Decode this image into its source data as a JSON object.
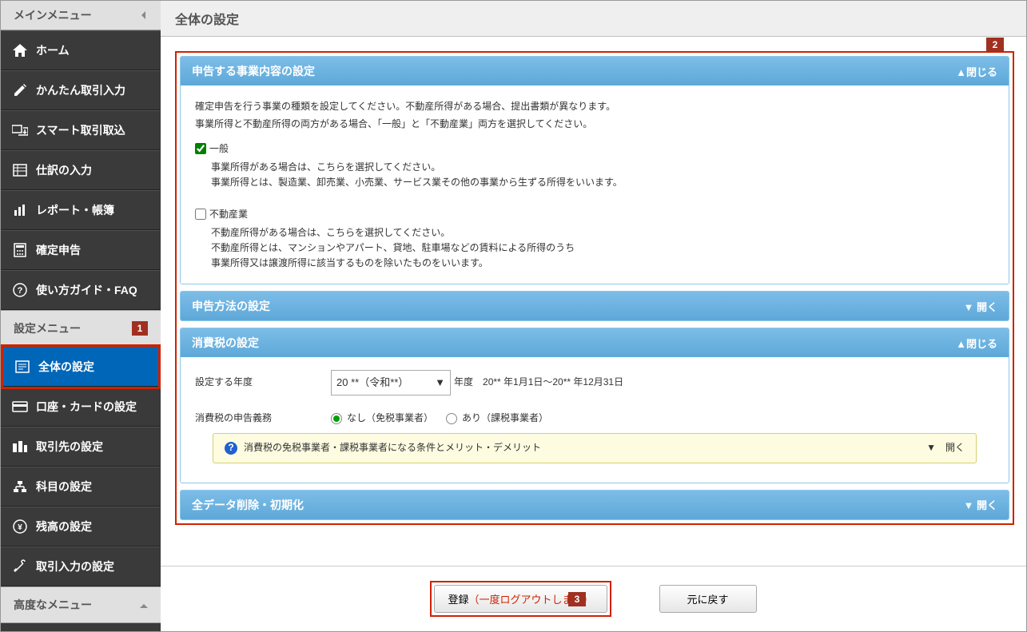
{
  "sidebar": {
    "main_menu_header": "メインメニュー",
    "items": [
      {
        "label": "ホーム"
      },
      {
        "label": "かんたん取引入力"
      },
      {
        "label": "スマート取引取込"
      },
      {
        "label": "仕訳の入力"
      },
      {
        "label": "レポート・帳簿"
      },
      {
        "label": "確定申告"
      },
      {
        "label": "使い方ガイド・FAQ"
      }
    ],
    "settings_header": "設定メニュー",
    "settings_items": [
      {
        "label": "全体の設定"
      },
      {
        "label": "口座・カードの設定"
      },
      {
        "label": "取引先の設定"
      },
      {
        "label": "科目の設定"
      },
      {
        "label": "残高の設定"
      },
      {
        "label": "取引入力の設定"
      }
    ],
    "advanced_header": "高度なメニュー"
  },
  "page_title": "全体の設定",
  "panels": {
    "business": {
      "title": "申告する事業内容の設定",
      "toggle": "▲閉じる",
      "desc1": "確定申告を行う事業の種類を設定してください。不動産所得がある場合、提出書類が異なります。",
      "desc2": "事業所得と不動産所得の両方がある場合、「一般」と「不動産業」両方を選択してください。",
      "opt1_label": "一般",
      "opt1_desc1": "事業所得がある場合は、こちらを選択してください。",
      "opt1_desc2": "事業所得とは、製造業、卸売業、小売業、サービス業その他の事業から生ずる所得をいいます。",
      "opt2_label": "不動産業",
      "opt2_desc1": "不動産所得がある場合は、こちらを選択してください。",
      "opt2_desc2": "不動産所得とは、マンションやアパート、貸地、駐車場などの賃料による所得のうち",
      "opt2_desc3": "事業所得又は譲渡所得に該当するものを除いたものをいいます。"
    },
    "method": {
      "title": "申告方法の設定",
      "toggle": "▼ 開く"
    },
    "tax": {
      "title": "消費税の設定",
      "toggle": "▲閉じる",
      "year_label": "設定する年度",
      "year_value": "20 **（令和**）",
      "year_suffix": "年度",
      "year_range": "20** 年1月1日～20** 年12月31日",
      "duty_label": "消費税の申告義務",
      "duty_none": "なし（免税事業者）",
      "duty_yes": "あり（課税事業者）",
      "info_text": "消費税の免税事業者・課税事業者になる条件とメリット・デメリット",
      "info_toggle": "▼　開く"
    },
    "delete": {
      "title": "全データ削除・初期化",
      "toggle": "▼ 開く"
    }
  },
  "footer": {
    "register_text": "登録",
    "register_red": "（一度ログアウトします）",
    "revert": "元に戻す"
  },
  "callouts": {
    "c1": "1",
    "c2": "2",
    "c3": "3"
  }
}
